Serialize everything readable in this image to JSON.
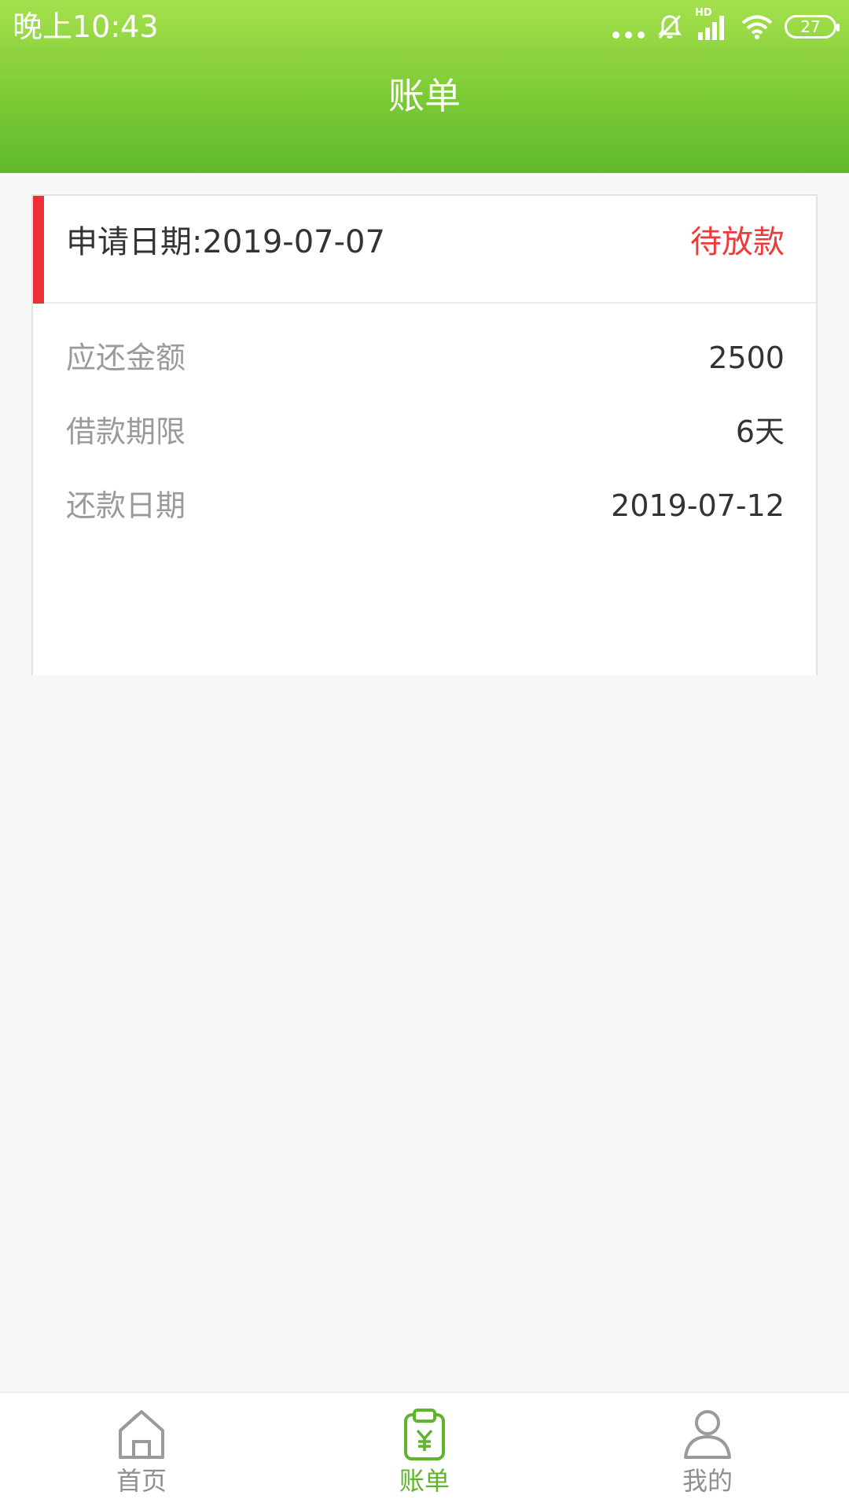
{
  "status_bar": {
    "time": "晚上10:43",
    "battery_level": "27",
    "network_label": "HD",
    "icons": [
      "more-dots-icon",
      "mute-bell-icon",
      "signal-icon",
      "wifi-icon",
      "battery-icon"
    ]
  },
  "header": {
    "title": "账单"
  },
  "bill_card": {
    "apply_date": "申请日期:2019-07-07",
    "status": "待放款",
    "rows": [
      {
        "label": "应还金额",
        "value": "2500"
      },
      {
        "label": "借款期限",
        "value": "6天"
      },
      {
        "label": "还款日期",
        "value": "2019-07-12"
      }
    ]
  },
  "bottom_nav": {
    "items": [
      {
        "label": "首页",
        "icon": "home-icon",
        "active": false
      },
      {
        "label": "账单",
        "icon": "bill-icon",
        "active": true
      },
      {
        "label": "我的",
        "icon": "profile-icon",
        "active": false
      }
    ]
  },
  "colors": {
    "header_green": "#7ccb35",
    "accent_red": "#ef2f37",
    "active_green": "#5db52b",
    "inactive_gray": "#8f8f8f"
  }
}
